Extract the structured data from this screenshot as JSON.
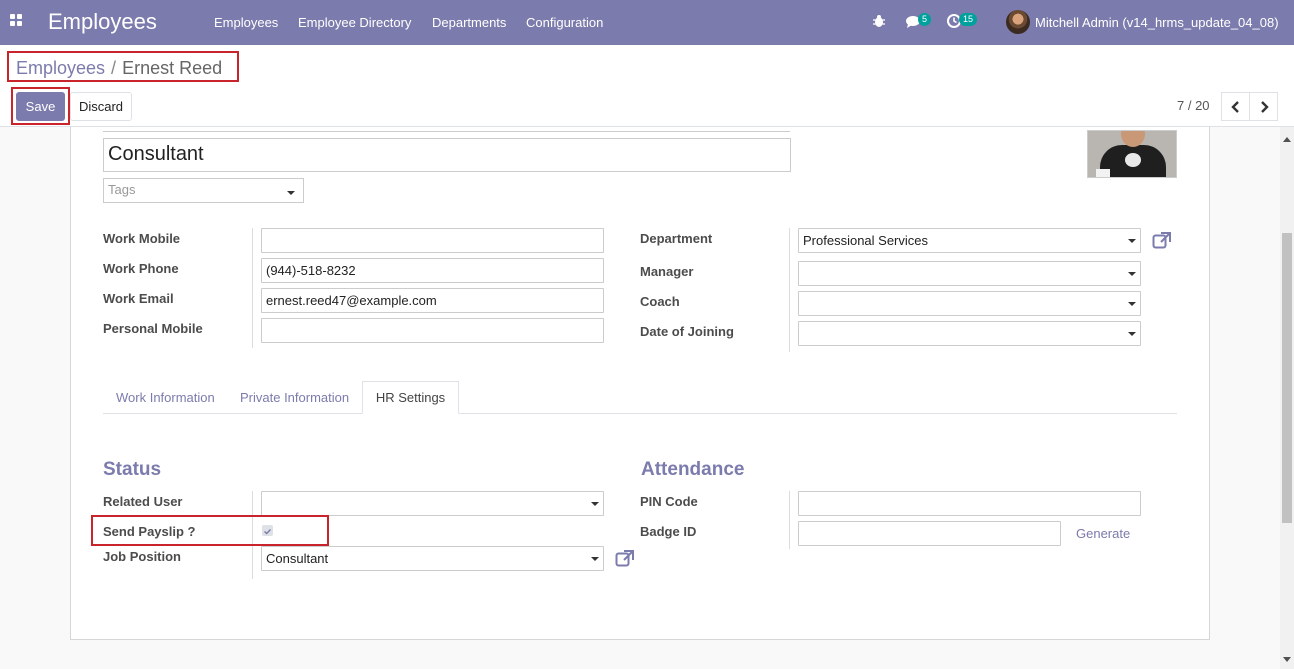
{
  "navbar": {
    "app_icon": "apps-grid-icon",
    "brand": "Employees",
    "menu": [
      "Employees",
      "Employee Directory",
      "Departments",
      "Configuration"
    ],
    "debug_icon": "bug-icon",
    "messages_icon": "chat-icon",
    "messages_count": "5",
    "activities_icon": "clock-icon",
    "activities_count": "15",
    "user": "Mitchell Admin (v14_hrms_update_04_08)"
  },
  "breadcrumb": {
    "parent": "Employees",
    "separator": "/",
    "current": "Ernest Reed"
  },
  "buttons": {
    "save": "Save",
    "discard": "Discard"
  },
  "pager": {
    "value": "7 / 20",
    "prev_icon": "chevron-left-icon",
    "next_icon": "chevron-right-icon"
  },
  "header_fields": {
    "job_title": "Consultant",
    "tags_placeholder": "Tags"
  },
  "left_fields": {
    "work_mobile_label": "Work Mobile",
    "work_mobile": "",
    "work_phone_label": "Work Phone",
    "work_phone": "(944)-518-8232",
    "work_email_label": "Work Email",
    "work_email": "ernest.reed47@example.com",
    "personal_mobile_label": "Personal Mobile",
    "personal_mobile": ""
  },
  "right_fields": {
    "department_label": "Department",
    "department": "Professional Services",
    "manager_label": "Manager",
    "manager": "",
    "coach_label": "Coach",
    "coach": "",
    "date_of_joining_label": "Date of Joining",
    "date_of_joining": ""
  },
  "tabs": [
    "Work Information",
    "Private Information",
    "HR Settings"
  ],
  "active_tab": "HR Settings",
  "status_section": {
    "title": "Status",
    "related_user_label": "Related User",
    "related_user": "",
    "send_payslip_label": "Send Payslip ?",
    "send_payslip_checked": true,
    "job_position_label": "Job Position",
    "job_position": "Consultant"
  },
  "attendance_section": {
    "title": "Attendance",
    "pin_code_label": "PIN Code",
    "pin_code": "",
    "badge_id_label": "Badge ID",
    "badge_id": "",
    "generate_label": "Generate"
  },
  "colors": {
    "brand": "#7c7bad",
    "badge": "#00a09d",
    "highlight": "#c9242b"
  }
}
